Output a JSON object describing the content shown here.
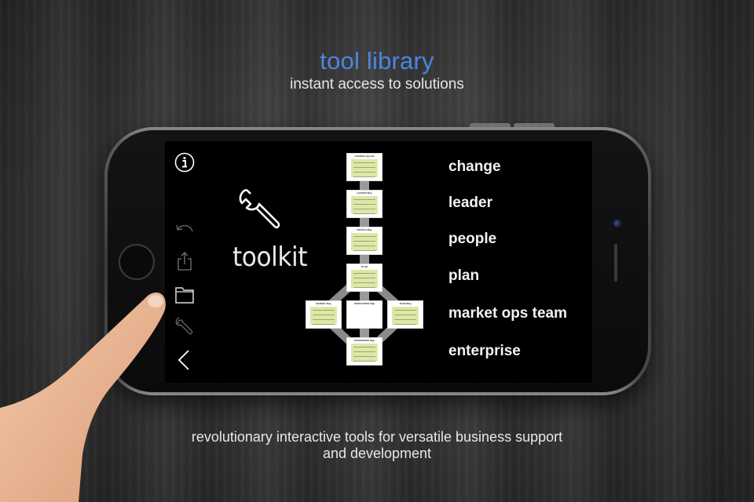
{
  "header": {
    "title": "tool library",
    "subtitle": "instant access to solutions"
  },
  "tagline": {
    "line1": "revolutionary interactive tools for versatile business support",
    "line2": "and development"
  },
  "colors": {
    "title_accent": "#4a86e0",
    "tile_fill": "#dde8a8"
  },
  "app": {
    "sidebar": [
      {
        "icon": "info-icon"
      },
      {
        "icon": "undo-icon"
      },
      {
        "icon": "share-icon"
      },
      {
        "icon": "folder-icon"
      },
      {
        "icon": "wrench-icon"
      },
      {
        "icon": "back-chevron-icon"
      }
    ],
    "toolkit_label": "toolkit",
    "diagram_tiles": [
      {
        "title": "CHANGE Agenda"
      },
      {
        "title": "LEADER Map"
      },
      {
        "title": "PEOPLE Map"
      },
      {
        "title": "PLAN"
      },
      {
        "title": "MARKET Map"
      },
      {
        "title": "OPERATIONS Map"
      },
      {
        "title": "TEAM Map"
      },
      {
        "title": "ENTERPRISE Map"
      }
    ],
    "menu": [
      {
        "label": "change"
      },
      {
        "label": "leader"
      },
      {
        "label": "people"
      },
      {
        "label": "plan"
      },
      {
        "label": "market ops team"
      },
      {
        "label": "enterprise"
      }
    ]
  }
}
